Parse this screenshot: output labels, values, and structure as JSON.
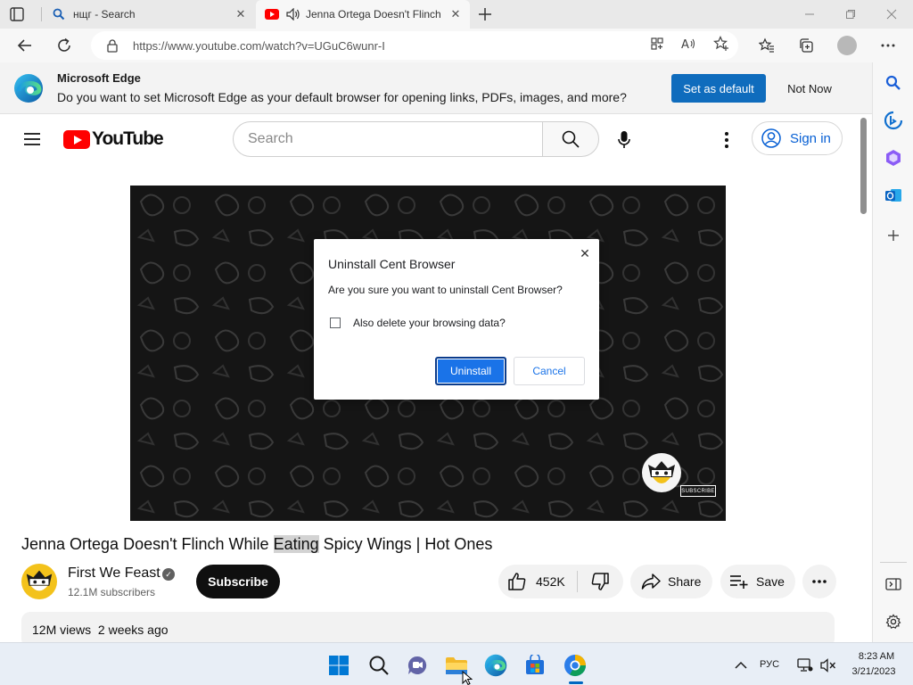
{
  "browser": {
    "tabs": [
      {
        "title": "нщг - Search",
        "favicon": "search-icon"
      },
      {
        "title": "Jenna Ortega Doesn't Flinch",
        "favicon": "youtube-icon",
        "audio": true
      }
    ],
    "url": "https://www.youtube.com/watch?v=UGuC6wunr-I",
    "accent_color": "#0f6cbd"
  },
  "banner": {
    "title": "Microsoft Edge",
    "message": "Do you want to set Microsoft Edge as your default browser for opening links, PDFs, images, and more?",
    "set_default_label": "Set as default",
    "not_now_label": "Not Now"
  },
  "youtube": {
    "logo_text": "YouTube",
    "search_placeholder": "Search",
    "signin_label": "Sign in",
    "video_title_before": "Jenna Ortega Doesn't Flinch While ",
    "video_title_highlight": "Eating",
    "video_title_after": " Spicy Wings | Hot Ones",
    "channel_name": "First We Feast",
    "subscribers": "12.1M subscribers",
    "subscribe_label": "Subscribe",
    "likes": "452K",
    "share_label": "Share",
    "save_label": "Save",
    "views": "12M views",
    "uploaded": "2 weeks ago",
    "watermark_subscribe": "SUBSCRIBE"
  },
  "dialog": {
    "title": "Uninstall Cent Browser",
    "message": "Are you sure you want to uninstall Cent Browser?",
    "checkbox_label": "Also delete your browsing data?",
    "checkbox_checked": false,
    "uninstall_label": "Uninstall",
    "cancel_label": "Cancel"
  },
  "taskbar": {
    "language": "РУС",
    "time": "8:23 AM",
    "date": "3/21/2023"
  }
}
